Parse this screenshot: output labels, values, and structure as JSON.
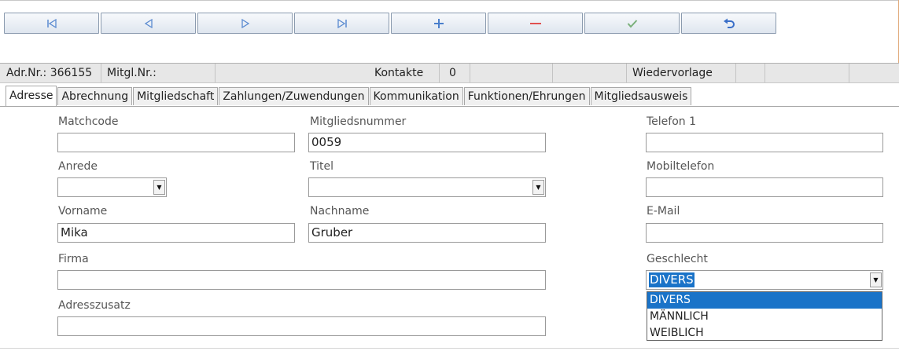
{
  "toolbar": {
    "buttons": [
      {
        "name": "first-record-icon",
        "color": "#5a8ad0"
      },
      {
        "name": "previous-record-icon",
        "color": "#5a8ad0"
      },
      {
        "name": "next-record-icon",
        "color": "#5a8ad0"
      },
      {
        "name": "last-record-icon",
        "color": "#5a8ad0"
      },
      {
        "name": "add-icon",
        "color": "#4a7fcc"
      },
      {
        "name": "delete-icon",
        "color": "#e05050"
      },
      {
        "name": "confirm-icon",
        "color": "#7ab07a"
      },
      {
        "name": "undo-icon",
        "color": "#3a6fc8"
      }
    ]
  },
  "infobar": {
    "adr_nr": "Adr.Nr.: 366155",
    "mitgl_nr": "Mitgl.Nr.:",
    "kontakte_label": "Kontakte",
    "kontakte_count": "0",
    "wiedervorlage": "Wiedervorlage"
  },
  "tabs": [
    {
      "label": "Adresse",
      "active": true
    },
    {
      "label": "Abrechnung",
      "active": false
    },
    {
      "label": "Mitgliedschaft",
      "active": false
    },
    {
      "label": "Zahlungen/Zuwendungen",
      "active": false
    },
    {
      "label": "Kommunikation",
      "active": false
    },
    {
      "label": "Funktionen/Ehrungen",
      "active": false
    },
    {
      "label": "Mitgliedsausweis",
      "active": false
    }
  ],
  "form": {
    "matchcode": {
      "label": "Matchcode",
      "value": ""
    },
    "mitgliedsnummer": {
      "label": "Mitgliedsnummer",
      "value": "0059"
    },
    "telefon1": {
      "label": "Telefon 1",
      "value": ""
    },
    "anrede": {
      "label": "Anrede",
      "value": ""
    },
    "titel": {
      "label": "Titel",
      "value": ""
    },
    "mobiltelefon": {
      "label": "Mobiltelefon",
      "value": ""
    },
    "vorname": {
      "label": "Vorname",
      "value": "Mika"
    },
    "nachname": {
      "label": "Nachname",
      "value": "Gruber"
    },
    "email": {
      "label": "E-Mail",
      "value": ""
    },
    "firma": {
      "label": "Firma",
      "value": ""
    },
    "geschlecht": {
      "label": "Geschlecht",
      "value": "DIVERS",
      "options": [
        "DIVERS",
        "MÄNNLICH",
        "WEIBLICH"
      ]
    },
    "adresszusatz": {
      "label": "Adresszusatz",
      "value": ""
    }
  },
  "colors": {
    "accent": "#1a73c8"
  }
}
